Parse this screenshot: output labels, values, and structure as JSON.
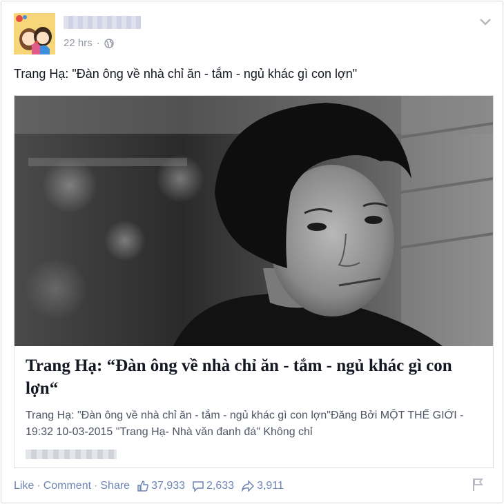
{
  "post": {
    "timestamp": "22 hrs",
    "separator": "·",
    "privacy_icon": "globe-icon",
    "text": "Trang Hạ: \"Đàn ông về nhà chỉ ăn - tắm - ngủ khác gì con lợn\""
  },
  "link": {
    "image_icon": "portrait-photo",
    "title": "Trang Hạ: “Đàn ông về nhà chỉ ăn - tắm - ngủ khác gì con lợn“",
    "description": "Trang Hạ: \"Đàn ông về nhà chỉ ăn - tắm - ngủ khác gì con lợn\"Đăng Bởi MỘT THẾ GIỚI - 19:32 10-03-2015 \"Trang Hạ- Nhà văn đanh đá\" Không chỉ"
  },
  "actions": {
    "like": "Like",
    "comment": "Comment",
    "share": "Share",
    "sep": "·"
  },
  "stats": {
    "likes": "37,933",
    "comments": "2,633",
    "shares": "3,911"
  },
  "colors": {
    "link": "#6d84b4",
    "meta": "#9197a3",
    "border": "#d3d6db"
  }
}
